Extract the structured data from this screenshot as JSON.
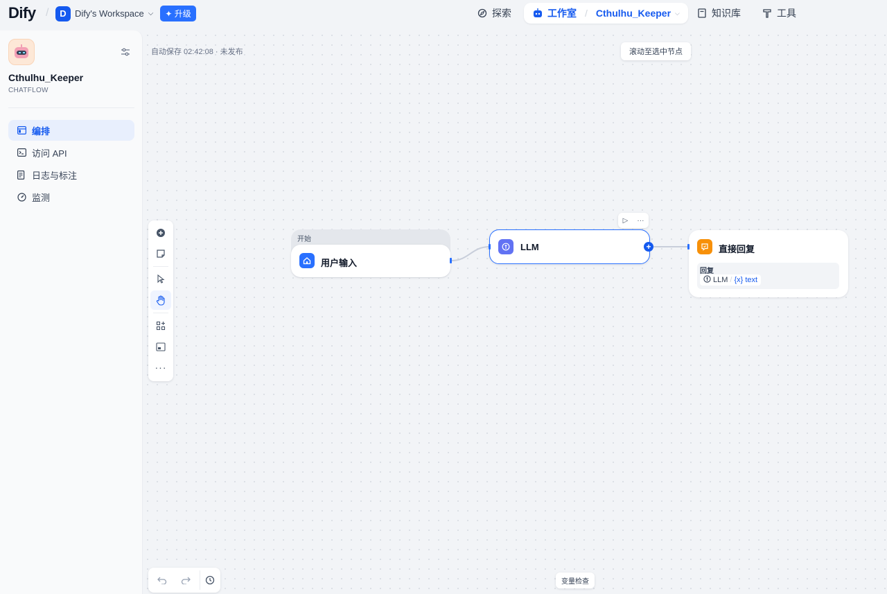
{
  "header": {
    "logo": "Dify",
    "workspace_initial": "D",
    "workspace_name": "Dify's Workspace",
    "upgrade_label": "升级",
    "nav": {
      "explore": "探索",
      "studio": "工作室",
      "current_app": "Cthulhu_Keeper",
      "knowledge": "知识库",
      "tools": "工具"
    }
  },
  "sidebar": {
    "app_name": "Cthulhu_Keeper",
    "app_type": "CHATFLOW",
    "items": [
      {
        "label": "编排",
        "icon": "layout-icon",
        "active": true
      },
      {
        "label": "访问 API",
        "icon": "terminal-icon",
        "active": false
      },
      {
        "label": "日志与标注",
        "icon": "file-list-icon",
        "active": false
      },
      {
        "label": "监测",
        "icon": "dashboard-icon",
        "active": false
      }
    ]
  },
  "canvas": {
    "autosave": "自动保存 02:42:08 · 未发布",
    "scroll_to_selected": "滚动至选中节点",
    "variable_inspect": "变量检查",
    "nodes": {
      "start": {
        "group_label": "开始",
        "title": "用户输入"
      },
      "llm": {
        "title": "LLM"
      },
      "answer": {
        "title": "直接回复",
        "field_label": "回复",
        "var_node": "LLM",
        "var_name": "text",
        "var_prefix": "{x}"
      }
    }
  },
  "colors": {
    "accent": "#155aef",
    "start_icon_bg": "#2970ff",
    "llm_icon_bg": "#6172f3",
    "answer_icon_bg": "#f79009"
  }
}
